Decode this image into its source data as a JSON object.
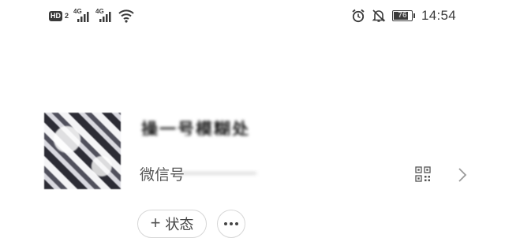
{
  "status_bar": {
    "hd_label": "HD",
    "hd_sub": "2",
    "sim1_type": "4G",
    "sim2_type": "4G",
    "battery_level": "76",
    "time": "14:54",
    "icons": [
      "signal-icon",
      "wifi-icon",
      "alarm-icon",
      "mute-bell-icon",
      "battery-icon"
    ]
  },
  "profile": {
    "nickname": "操一号模糊处",
    "wechat_id_label": "微信号",
    "wechat_id_value": "——————"
  },
  "actions": {
    "status_label": "状态"
  }
}
